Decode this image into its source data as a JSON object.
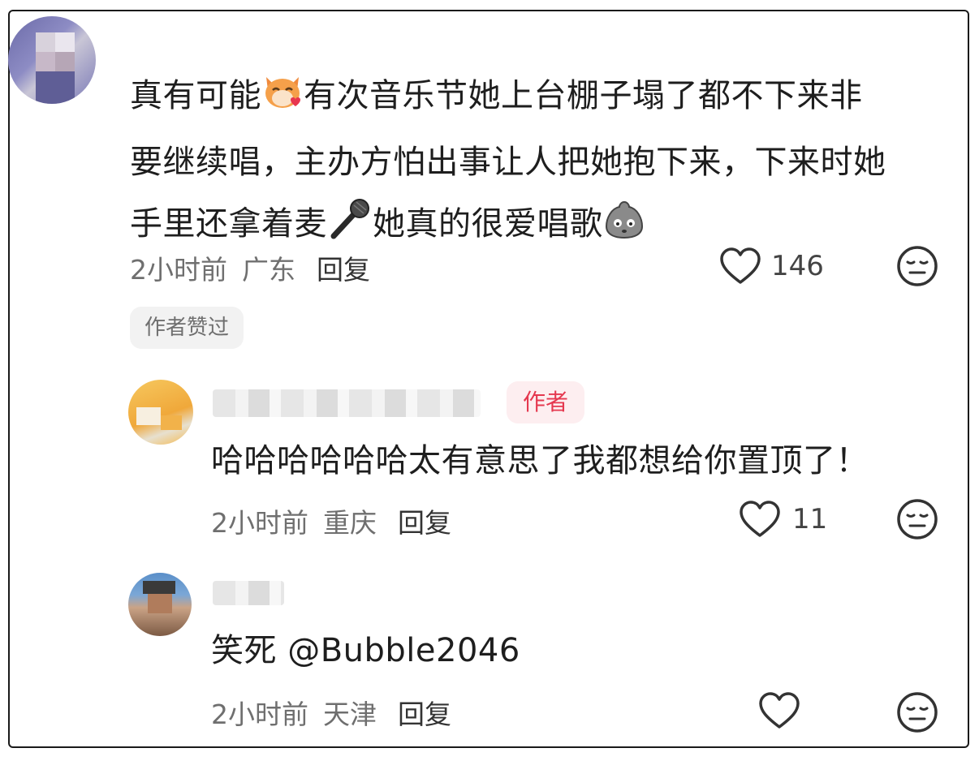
{
  "comment1": {
    "line1_a": "真有可能",
    "line1_b": "有次音乐节她上台棚子塌了都不下来非",
    "line2": "要继续唱，主办方怕出事让人把她抱下来，下来时她",
    "line3_a": "手里还拿着麦",
    "line3_b": "她真的很爱唱歌",
    "time": "2小时前",
    "location": "广东",
    "reply_label": "回复",
    "likes": "146",
    "liked_by_author": "作者赞过",
    "emoji_1": "cat-heart-emoji",
    "emoji_2": "microphone-emoji",
    "emoji_3": "sad-blob-emoji"
  },
  "comment2": {
    "author_badge": "作者",
    "text": "哈哈哈哈哈哈太有意思了我都想给你置顶了！",
    "time": "2小时前",
    "location": "重庆",
    "reply_label": "回复",
    "likes": "11"
  },
  "comment3": {
    "text": "笑死 @Bubble2046",
    "time": "2小时前",
    "location": "天津",
    "reply_label": "回复"
  },
  "colors": {
    "badge_red": "#e5384f",
    "badge_bg": "#fdeef0",
    "chip_bg": "#f2f2f2",
    "meta_gray": "#6f6f6f"
  }
}
